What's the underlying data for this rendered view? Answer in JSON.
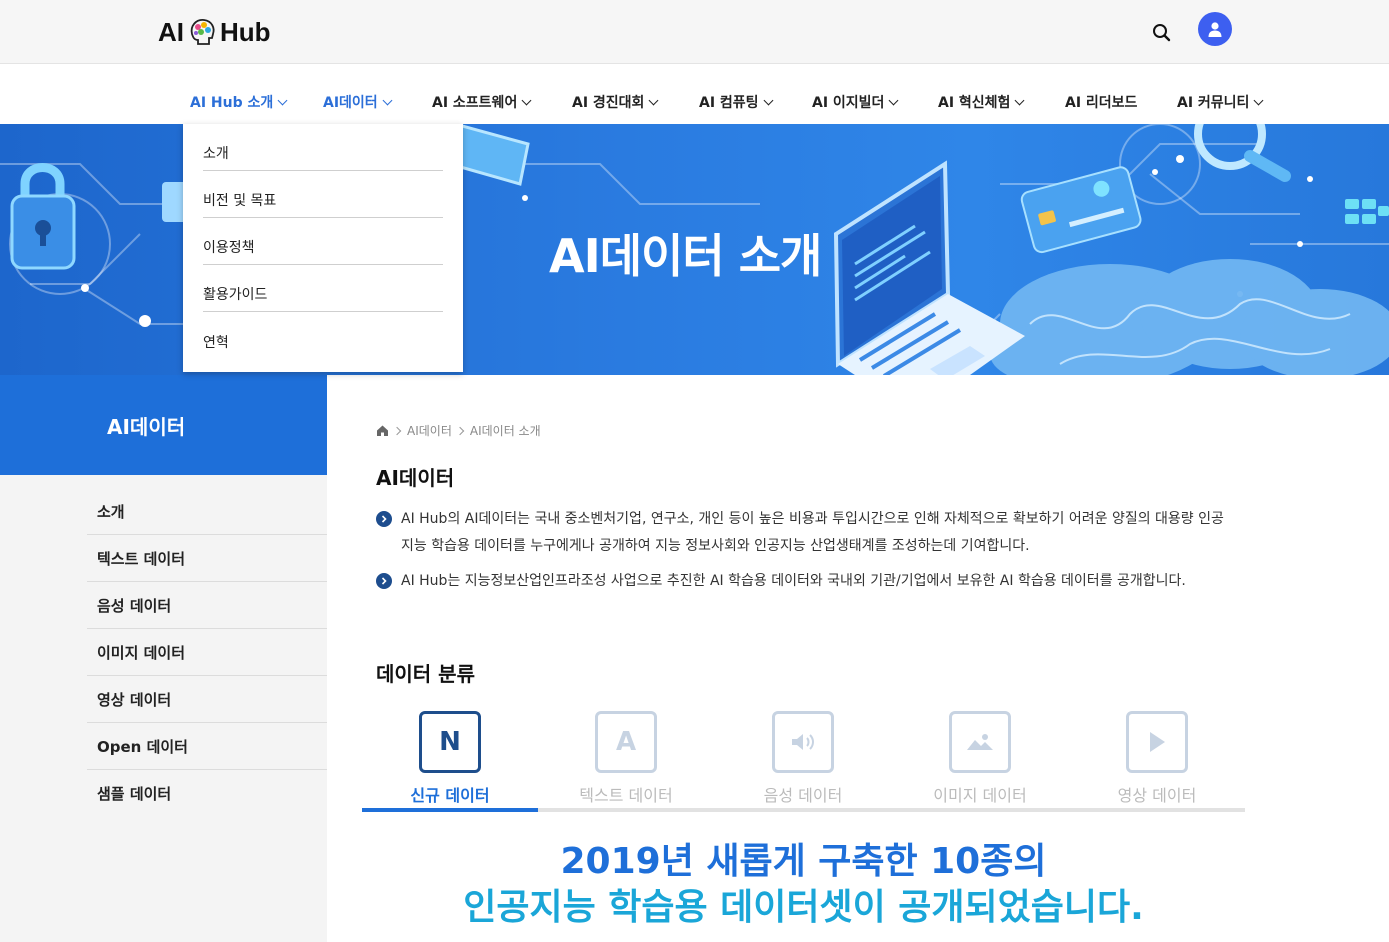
{
  "header": {
    "logo_left": "AI",
    "logo_right": "Hub",
    "search_icon": "search-icon",
    "user_icon": "user-icon"
  },
  "nav": {
    "items": [
      {
        "label": "AI Hub 소개"
      },
      {
        "label": "AI데이터"
      },
      {
        "label": "AI 소프트웨어"
      },
      {
        "label": "AI 경진대회"
      },
      {
        "label": "AI 컴퓨팅"
      },
      {
        "label": "AI 이지빌더"
      },
      {
        "label": "AI 혁신체험"
      },
      {
        "label": "AI 리더보드"
      },
      {
        "label": "AI 커뮤니티"
      }
    ]
  },
  "dropdown": {
    "items": [
      "소개",
      "비전 및 목표",
      "이용정책",
      "활용가이드",
      "연혁"
    ]
  },
  "hero": {
    "title": "AI데이터 소개"
  },
  "sidebar": {
    "title": "AI데이터",
    "items": [
      "소개",
      "텍스트 데이터",
      "음성 데이터",
      "이미지 데이터",
      "영상 데이터",
      "Open 데이터",
      "샘플 데이터"
    ]
  },
  "breadcrumb": {
    "home_icon": "home-icon",
    "level1": "AI데이터",
    "level2": "AI데이터 소개"
  },
  "section1": {
    "title": "AI데이터",
    "bullets": [
      "AI Hub의 AI데이터는 국내 중소벤처기업, 연구소, 개인 등이 높은 비용과 투입시간으로 인해 자체적으로 확보하기 어려운 양질의 대용량 인공지능 학습용 데이터를 누구에게나 공개하여 지능 정보사회와 인공지능 산업생태계를 조성하는데 기여합니다.",
      "AI Hub는 지능정보산업인프라조성 사업으로 추진한 AI 학습용 데이터와 국내외 기관/기업에서 보유한 AI 학습용 데이터를 공개합니다."
    ]
  },
  "section2": {
    "title": "데이터 분류",
    "tabs": [
      {
        "label": "신규 데이터",
        "icon_text": "N",
        "icon": "new-icon"
      },
      {
        "label": "텍스트 데이터",
        "icon_text": "A",
        "icon": "text-icon"
      },
      {
        "label": "음성 데이터",
        "icon": "speaker-icon"
      },
      {
        "label": "이미지 데이터",
        "icon": "image-icon"
      },
      {
        "label": "영상 데이터",
        "icon": "play-icon"
      }
    ],
    "active_tab": "신규 데이터"
  },
  "headline": {
    "line1": "2019년 새롭게 구축한 10종의",
    "line2": "인공지능 학습용 데이터셋이 공개되었습니다."
  },
  "colors": {
    "accent": "#1e6fd9",
    "navy": "#1e4e8c",
    "cyan": "#1aa6d8",
    "user_avatar": "#3d5ff0"
  }
}
